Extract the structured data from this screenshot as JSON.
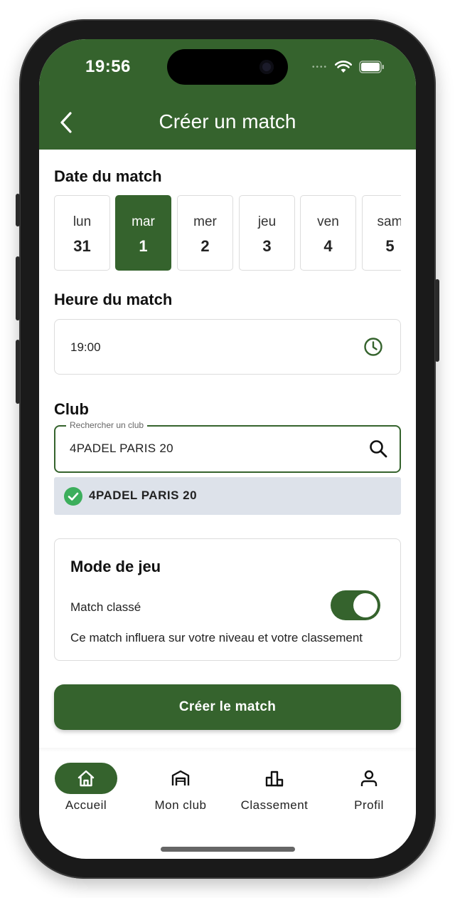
{
  "status_bar": {
    "time": "19:56",
    "dots": "••••"
  },
  "header": {
    "title": "Créer un match"
  },
  "date_section": {
    "title": "Date du match",
    "days": [
      {
        "day": "lun",
        "num": "31"
      },
      {
        "day": "mar",
        "num": "1"
      },
      {
        "day": "mer",
        "num": "2"
      },
      {
        "day": "jeu",
        "num": "3"
      },
      {
        "day": "ven",
        "num": "4"
      },
      {
        "day": "sam",
        "num": "5"
      }
    ],
    "selected_index": 1
  },
  "time_section": {
    "title": "Heure du match",
    "value": "19:00"
  },
  "club_section": {
    "title": "Club",
    "search_label": "Rechercher un club",
    "search_value": "4PADEL PARIS 20",
    "selected_result": "4PADEL PARIS 20"
  },
  "mode_section": {
    "title": "Mode de jeu",
    "toggle_label": "Match classé",
    "toggle_on": true,
    "description": "Ce match influera sur votre niveau et votre classement"
  },
  "submit": {
    "label": "Créer le match"
  },
  "bottom_nav": {
    "items": [
      {
        "label": "Accueil",
        "icon": "home-icon",
        "active": true
      },
      {
        "label": "Mon club",
        "icon": "club-icon",
        "active": false
      },
      {
        "label": "Classement",
        "icon": "ranking-icon",
        "active": false
      },
      {
        "label": "Profil",
        "icon": "profile-icon",
        "active": false
      }
    ]
  },
  "colors": {
    "primary": "#35632d",
    "selected_result_bg": "#dde2ea",
    "check": "#3cae5c"
  }
}
